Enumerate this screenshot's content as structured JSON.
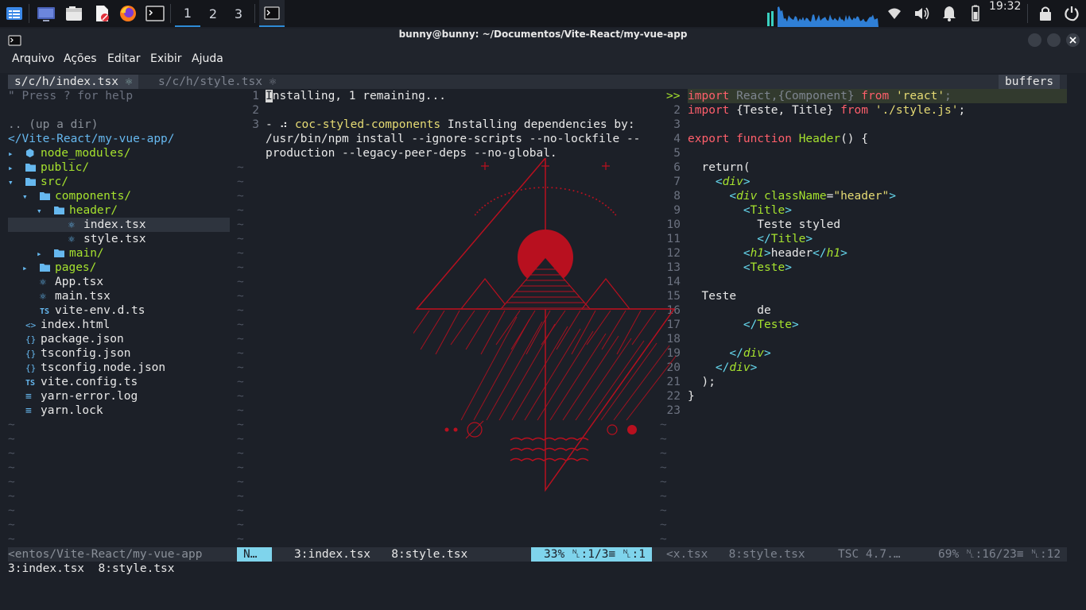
{
  "taskbar": {
    "workspaces": [
      "1",
      "2",
      "3"
    ],
    "active_workspace": "1",
    "clock": "19:32",
    "icons": [
      "app-menu-icon",
      "desktop-icon",
      "file-manager-icon",
      "text-editor-icon",
      "firefox-icon",
      "terminal-icon",
      "terminal-window-icon",
      "wifi-icon",
      "volume-icon",
      "bell-icon",
      "battery-icon",
      "lock-icon",
      "power-icon"
    ]
  },
  "window": {
    "title": "bunny@bunny: ~/Documentos/Vite-React/my-vue-app",
    "menu": [
      "Arquivo",
      "Ações",
      "Editar",
      "Exibir",
      "Ajuda"
    ]
  },
  "vim": {
    "tabline": {
      "tabs": [
        "s/c/h/index.tsx",
        "s/c/h/style.tsx"
      ],
      "right_label": "buffers"
    },
    "tree": {
      "help": "\" Press ? for help",
      "updir": ".. (up a dir)",
      "root": "</Vite-React/my-vue-app/",
      "items": [
        {
          "indent": 0,
          "arrow": "▸",
          "icon": "node-icon",
          "label": "node_modules/",
          "color": "green"
        },
        {
          "indent": 0,
          "arrow": "▸",
          "icon": "folder-icon",
          "label": "public/",
          "color": "green"
        },
        {
          "indent": 0,
          "arrow": "▾",
          "icon": "folder-icon",
          "label": "src/",
          "color": "green"
        },
        {
          "indent": 1,
          "arrow": "▾",
          "icon": "folder-icon",
          "label": "components/",
          "color": "green"
        },
        {
          "indent": 2,
          "arrow": "▾",
          "icon": "folder-icon",
          "label": "header/",
          "color": "green"
        },
        {
          "indent": 3,
          "arrow": "",
          "icon": "react-icon",
          "label": "index.tsx",
          "color": "white",
          "selected": true
        },
        {
          "indent": 3,
          "arrow": "",
          "icon": "react-icon",
          "label": "style.tsx",
          "color": "white"
        },
        {
          "indent": 2,
          "arrow": "▸",
          "icon": "folder-icon",
          "label": "main/",
          "color": "green"
        },
        {
          "indent": 1,
          "arrow": "▸",
          "icon": "folder-icon",
          "label": "pages/",
          "color": "green"
        },
        {
          "indent": 1,
          "arrow": "",
          "icon": "react-icon",
          "label": "App.tsx",
          "color": "white"
        },
        {
          "indent": 1,
          "arrow": "",
          "icon": "react-icon",
          "label": "main.tsx",
          "color": "white"
        },
        {
          "indent": 1,
          "arrow": "",
          "icon": "ts-icon",
          "label": "vite-env.d.ts",
          "color": "white"
        },
        {
          "indent": 0,
          "arrow": "",
          "icon": "html-icon",
          "label": "index.html",
          "color": "white"
        },
        {
          "indent": 0,
          "arrow": "",
          "icon": "json-icon",
          "label": "package.json",
          "color": "white"
        },
        {
          "indent": 0,
          "arrow": "",
          "icon": "json-icon",
          "label": "tsconfig.json",
          "color": "white"
        },
        {
          "indent": 0,
          "arrow": "",
          "icon": "json-icon",
          "label": "tsconfig.node.json",
          "color": "white"
        },
        {
          "indent": 0,
          "arrow": "",
          "icon": "ts-icon",
          "label": "vite.config.ts",
          "color": "white"
        },
        {
          "indent": 0,
          "arrow": "",
          "icon": "log-icon",
          "label": "yarn-error.log",
          "color": "white"
        },
        {
          "indent": 0,
          "arrow": "",
          "icon": "log-icon",
          "label": "yarn.lock",
          "color": "white"
        }
      ]
    },
    "middle": {
      "lines": [
        {
          "n": "1",
          "text": "Installing, 1 remaining..."
        },
        {
          "n": "2",
          "text": ""
        },
        {
          "n": "3",
          "text": "- ⠴ coc-styled-components Installing dependencies by:"
        },
        {
          "n": "",
          "text": "/usr/bin/npm install --ignore-scripts --no-lockfile --"
        },
        {
          "n": "",
          "text": "production --legacy-peer-deps --no-global."
        }
      ]
    },
    "right": {
      "gutter_marker": ">>",
      "line_numbers": [
        "1",
        "2",
        "3",
        "4",
        "5",
        "6",
        "7",
        "8",
        "9",
        "10",
        "11",
        "12",
        "13",
        "14",
        "15",
        "16",
        "17",
        "18",
        "19",
        "20",
        "21",
        "22",
        "23"
      ]
    },
    "statusline": {
      "left_path": "<entos/Vite-React/my-vue-app",
      "mode": "N…",
      "buffers": "3:index.tsx   8:style.tsx",
      "position": "33% ␤:1/3≡ ␤:1",
      "right_buffers": "<x.tsx   8:style.tsx",
      "tsc": "TSC 4.7.…",
      "right_position": "69% ␤:16/23≡ ␤:12"
    },
    "cmdline": "3:index.tsx  8:style.tsx"
  },
  "colors": {
    "accent": "#2e8bd6",
    "statusline_mode": "#7fd4ec",
    "art_red": "#c8102e"
  }
}
